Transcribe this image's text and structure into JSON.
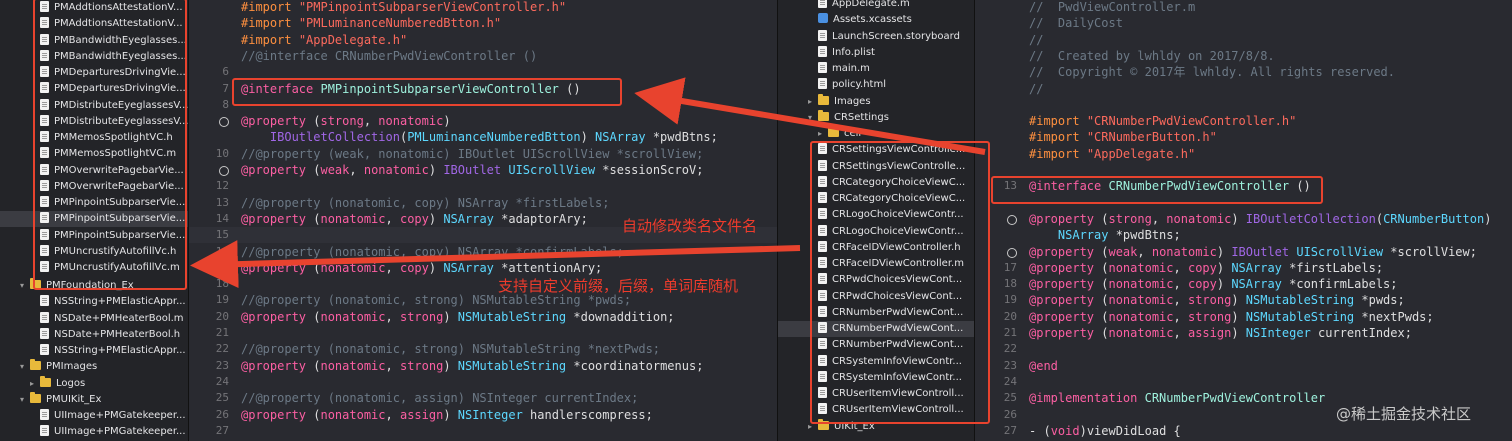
{
  "left_navigator": {
    "files": [
      "PMAddtionsAttestationV...",
      "PMAddtionsAttestationV...",
      "PMBandwidthEyeglasses...",
      "PMBandwidthEyeglasses...",
      "PMDeparturesDrivingVie...",
      "PMDeparturesDrivingVie...",
      "PMDistributeEyeglassesV...",
      "PMDistributeEyeglassesV...",
      "PMMemosSpotlightVC.h",
      "PMMemosSpotlightVC.m",
      "PMOverwritePagebarVie...",
      "PMOverwritePagebarVie...",
      "PMPinpointSubparserVie...",
      "PMPinpointSubparserVie...",
      "PMPinpointSubparserVie...",
      "PMUncrustifyAutofillVc.h",
      "PMUncrustifyAutofillVc.m"
    ],
    "foundation_group": "PMFoundation_Ex",
    "foundation_files": [
      "NSString+PMElasticAppr...",
      "NSDate+PMHeaterBool.m",
      "NSDate+PMHeaterBool.h",
      "NSString+PMElasticAppr..."
    ],
    "images_group": "PMImages",
    "logos_folder": "Logos",
    "uikit_group": "PMUIKit_Ex",
    "uikit_files": [
      "UIImage+PMGatekeeper...",
      "UIImage+PMGatekeeper..."
    ]
  },
  "left_editor": {
    "lines": [
      {
        "n": "",
        "html": "<span class='pp'>#import</span> <span class='str'>\"PMPinpointSubparserViewController.h\"</span>"
      },
      {
        "n": "",
        "html": "<span class='pp'>#import</span> <span class='str'>\"PMLuminanceNumberedBtton.h\"</span>"
      },
      {
        "n": "",
        "html": "<span class='pp'>#import</span> <span class='str'>\"AppDelegate.h\"</span>"
      },
      {
        "n": "",
        "html": "<span class='cm'>//@interface CRNumberPwdViewController ()</span>"
      },
      {
        "n": "6",
        "html": ""
      },
      {
        "n": "7",
        "html": "<span class='kw'>@interface</span> <span class='cls'>PMPinpointSubparserViewController</span> ()"
      },
      {
        "n": "8",
        "html": ""
      },
      {
        "n": "",
        "html": "<span class='kw'>@property</span> (<span class='kw'>strong</span>, <span class='kw'>nonatomic</span>)"
      },
      {
        "n": "",
        "html": "    <span class='mac'>IBOutletCollection</span>(<span class='ty'>PMLuminanceNumberedBtton</span>) <span class='ty'>NSArray</span> *pwdBtns;"
      },
      {
        "n": "10",
        "html": "<span class='cm'>//@property (weak, nonatomic) IBOutlet UIScrollView *scrollView;</span>"
      },
      {
        "n": "",
        "html": "<span class='kw'>@property</span> (<span class='kw'>weak</span>, <span class='kw'>nonatomic</span>) <span class='mac'>IBOutlet</span> <span class='ty'>UIScrollView</span> *sessionScroV;"
      },
      {
        "n": "12",
        "html": ""
      },
      {
        "n": "13",
        "html": "<span class='cm'>//@property (nonatomic, copy) NSArray *firstLabels;</span>"
      },
      {
        "n": "14",
        "html": "<span class='kw'>@property</span> (<span class='kw'>nonatomic</span>, <span class='kw'>copy</span>) <span class='ty'>NSArray</span> *adaptorAry;"
      },
      {
        "n": "15",
        "html": ""
      },
      {
        "n": "16",
        "html": "<span class='cm'>//@property (nonatomic, copy) NSArray *confirmLabels;</span>"
      },
      {
        "n": "17",
        "html": "<span class='kw'>@property</span> (<span class='kw'>nonatomic</span>, <span class='kw'>copy</span>) <span class='ty'>NSArray</span> *attentionAry;"
      },
      {
        "n": "18",
        "html": ""
      },
      {
        "n": "19",
        "html": "<span class='cm'>//@property (nonatomic, strong) NSMutableString *pwds;</span>"
      },
      {
        "n": "20",
        "html": "<span class='kw'>@property</span> (<span class='kw'>nonatomic</span>, <span class='kw'>strong</span>) <span class='ty'>NSMutableString</span> *downaddition;"
      },
      {
        "n": "21",
        "html": ""
      },
      {
        "n": "22",
        "html": "<span class='cm'>//@property (nonatomic, strong) NSMutableString *nextPwds;</span>"
      },
      {
        "n": "23",
        "html": "<span class='kw'>@property</span> (<span class='kw'>nonatomic</span>, <span class='kw'>strong</span>) <span class='ty'>NSMutableString</span> *coordinatormenus;"
      },
      {
        "n": "24",
        "html": ""
      },
      {
        "n": "25",
        "html": "<span class='cm'>//@property (nonatomic, assign) NSInteger currentIndex;</span>"
      },
      {
        "n": "26",
        "html": "<span class='kw'>@property</span> (<span class='kw'>nonatomic</span>, <span class='kw'>assign</span>) <span class='ty'>NSInteger</span> handlerscompress;"
      },
      {
        "n": "27",
        "html": ""
      }
    ]
  },
  "right_navigator": {
    "rows": [
      {
        "t": "file",
        "label": "AppDelegate.m"
      },
      {
        "t": "asset",
        "label": "Assets.xcassets"
      },
      {
        "t": "file",
        "label": "LaunchScreen.storyboard"
      },
      {
        "t": "file",
        "label": "Info.plist"
      },
      {
        "t": "file",
        "label": "main.m"
      },
      {
        "t": "file",
        "label": "policy.html"
      },
      {
        "t": "folder",
        "label": "Images"
      },
      {
        "t": "folder",
        "label": "CRSettings"
      },
      {
        "t": "folder",
        "label": "cell"
      },
      {
        "t": "file",
        "label": "CRSettingsViewControlle..."
      },
      {
        "t": "file",
        "label": "CRSettingsViewControlle..."
      },
      {
        "t": "file",
        "label": "CRCategoryChoiceViewC..."
      },
      {
        "t": "file",
        "label": "CRCategoryChoiceViewC..."
      },
      {
        "t": "file",
        "label": "CRLogoChoiceViewContr..."
      },
      {
        "t": "file",
        "label": "CRLogoChoiceViewContr..."
      },
      {
        "t": "file",
        "label": "CRFaceIDViewController.h"
      },
      {
        "t": "file",
        "label": "CRFaceIDViewController.m"
      },
      {
        "t": "file",
        "label": "CRPwdChoicesViewCont..."
      },
      {
        "t": "file",
        "label": "CRPwdChoicesViewCont..."
      },
      {
        "t": "file",
        "label": "CRNumberPwdViewCont..."
      },
      {
        "t": "file",
        "label": "CRNumberPwdViewCont..."
      },
      {
        "t": "file",
        "label": "CRNumberPwdViewCont..."
      },
      {
        "t": "file",
        "label": "CRSystemInfoViewContr..."
      },
      {
        "t": "file",
        "label": "CRSystemInfoViewContr..."
      },
      {
        "t": "file",
        "label": "CRUserItemViewControll..."
      },
      {
        "t": "file",
        "label": "CRUserItemViewControll..."
      },
      {
        "t": "folder",
        "label": "UIKit_Ex"
      }
    ]
  },
  "right_editor": {
    "lines": [
      {
        "n": "",
        "html": "<span class='cm'>//  PwdViewController.m</span>"
      },
      {
        "n": "",
        "html": "<span class='cm'>//  DailyCost</span>"
      },
      {
        "n": "",
        "html": "<span class='cm'>//</span>"
      },
      {
        "n": "",
        "html": "<span class='cm'>//  Created by lwhldy on 2017/8/8.</span>"
      },
      {
        "n": "",
        "html": "<span class='cm'>//  Copyright © 2017年 lwhldy. All rights reserved.</span>"
      },
      {
        "n": "",
        "html": "<span class='cm'>//</span>"
      },
      {
        "n": "",
        "html": ""
      },
      {
        "n": "",
        "html": "<span class='pp'>#import</span> <span class='str'>\"CRNumberPwdViewController.h\"</span>"
      },
      {
        "n": "",
        "html": "<span class='pp'>#import</span> <span class='str'>\"CRNumberButton.h\"</span>"
      },
      {
        "n": "",
        "html": "<span class='pp'>#import</span> <span class='str'>\"AppDelegate.h\"</span>"
      },
      {
        "n": "",
        "html": ""
      },
      {
        "n": "13",
        "html": "<span class='kw'>@interface</span> <span class='cls'>CRNumberPwdViewController</span> ()"
      },
      {
        "n": "",
        "html": ""
      },
      {
        "n": "",
        "html": "<span class='kw'>@property</span> (<span class='kw'>strong</span>, <span class='kw'>nonatomic</span>) <span class='mac'>IBOutletCollection</span>(<span class='ty'>CRNumberButton</span>)"
      },
      {
        "n": "",
        "html": "    <span class='ty'>NSArray</span> *pwdBtns;"
      },
      {
        "n": "",
        "html": "<span class='kw'>@property</span> (<span class='kw'>weak</span>, <span class='kw'>nonatomic</span>) <span class='mac'>IBOutlet</span> <span class='ty'>UIScrollView</span> *scrollView;"
      },
      {
        "n": "17",
        "html": "<span class='kw'>@property</span> (<span class='kw'>nonatomic</span>, <span class='kw'>copy</span>) <span class='ty'>NSArray</span> *firstLabels;"
      },
      {
        "n": "18",
        "html": "<span class='kw'>@property</span> (<span class='kw'>nonatomic</span>, <span class='kw'>copy</span>) <span class='ty'>NSArray</span> *confirmLabels;"
      },
      {
        "n": "19",
        "html": "<span class='kw'>@property</span> (<span class='kw'>nonatomic</span>, <span class='kw'>strong</span>) <span class='ty'>NSMutableString</span> *pwds;"
      },
      {
        "n": "20",
        "html": "<span class='kw'>@property</span> (<span class='kw'>nonatomic</span>, <span class='kw'>strong</span>) <span class='ty'>NSMutableString</span> *nextPwds;"
      },
      {
        "n": "21",
        "html": "<span class='kw'>@property</span> (<span class='kw'>nonatomic</span>, <span class='kw'>assign</span>) <span class='ty'>NSInteger</span> currentIndex;"
      },
      {
        "n": "22",
        "html": ""
      },
      {
        "n": "23",
        "html": "<span class='kw'>@end</span>"
      },
      {
        "n": "24",
        "html": ""
      },
      {
        "n": "25",
        "html": "<span class='kw'>@implementation</span> <span class='cls'>CRNumberPwdViewController</span>"
      },
      {
        "n": "26",
        "html": ""
      },
      {
        "n": "27",
        "html": "- (<span class='kw'>void</span>)viewDidLoad {"
      }
    ]
  },
  "annotations": {
    "rename_note": "自动修改类名文件名",
    "prefix_note": "支持自定义前缀，后缀，单词库随机"
  },
  "watermark": "@稀土掘金技术社区",
  "colors": {
    "annotation": "#e8432e",
    "keyword": "#fc5fa3",
    "string": "#fc6a5d",
    "comment": "#6c7986",
    "type": "#5dd8ff"
  }
}
